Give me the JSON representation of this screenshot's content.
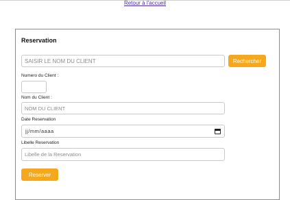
{
  "header": {
    "back_link": "Retour à l'accueil"
  },
  "panel": {
    "title": "Reservation",
    "search": {
      "placeholder": "SAISIR LE NOM DU CLIENT",
      "button": "Rechercher"
    },
    "fields": {
      "numero": {
        "label": "Numero du Client :",
        "value": ""
      },
      "nom": {
        "label": "Nom du Client :",
        "placeholder": "NOM DU CLIENT"
      },
      "date": {
        "label": "Date Reservation",
        "placeholder": "jj/mm/aaaa",
        "icon": "calendar-icon"
      },
      "libelle": {
        "label": "Libelle Reservation",
        "placeholder": "Libelle de la Reservation"
      }
    },
    "reserve_button": "Reserver"
  },
  "colors": {
    "accent": "#f6a81c",
    "link": "#4a2fa0",
    "border": "#8a8a8a"
  }
}
